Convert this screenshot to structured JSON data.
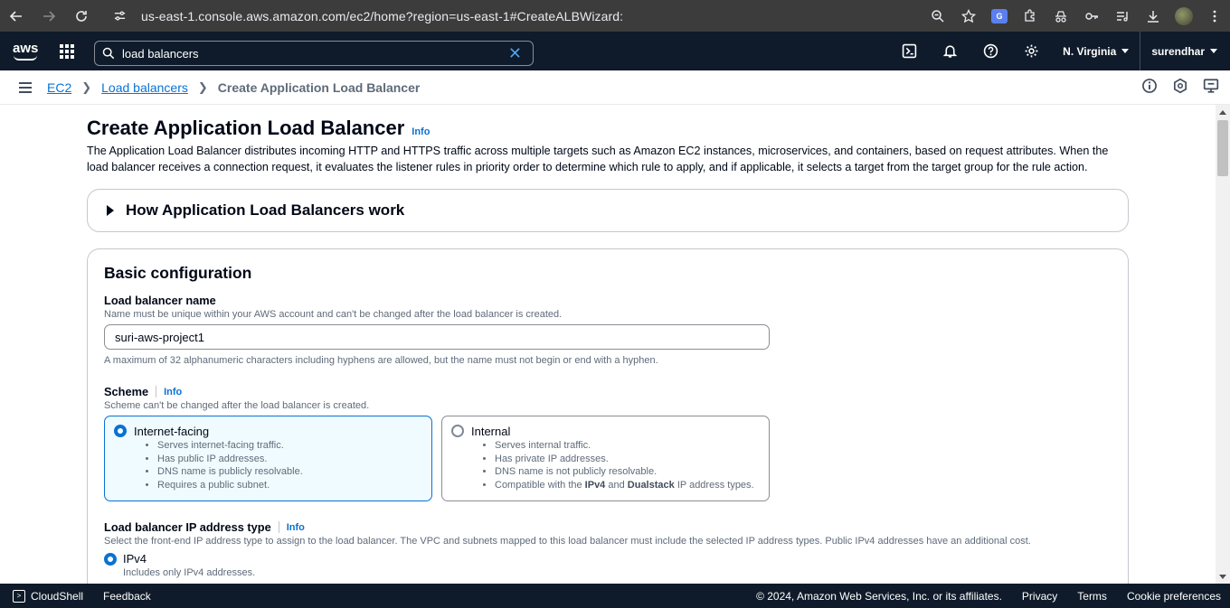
{
  "browser": {
    "url": "us-east-1.console.aws.amazon.com/ec2/home?region=us-east-1#CreateALBWizard:",
    "extension_badge": "G"
  },
  "aws_nav": {
    "logo": "aws",
    "search_value": "load balancers",
    "region": "N. Virginia",
    "user": "surendhar"
  },
  "breadcrumb": {
    "items": [
      "EC2",
      "Load balancers"
    ],
    "current": "Create Application Load Balancer"
  },
  "page": {
    "title": "Create Application Load Balancer",
    "info_label": "Info",
    "description": "The Application Load Balancer distributes incoming HTTP and HTTPS traffic across multiple targets such as Amazon EC2 instances, microservices, and containers, based on request attributes. When the load balancer receives a connection request, it evaluates the listener rules in priority order to determine which rule to apply, and if applicable, it selects a target from the target group for the rule action.",
    "expander_title": "How Application Load Balancers work"
  },
  "basic_config": {
    "title": "Basic configuration",
    "name_label": "Load balancer name",
    "name_desc": "Name must be unique within your AWS account and can't be changed after the load balancer is created.",
    "name_value": "suri-aws-project1",
    "name_constraint": "A maximum of 32 alphanumeric characters including hyphens are allowed, but the name must not begin or end with a hyphen.",
    "scheme_label": "Scheme",
    "scheme_info": "Info",
    "scheme_desc": "Scheme can't be changed after the load balancer is created.",
    "internet_facing": {
      "title": "Internet-facing",
      "bullets": [
        "Serves internet-facing traffic.",
        "Has public IP addresses.",
        "DNS name is publicly resolvable.",
        "Requires a public subnet."
      ]
    },
    "internal": {
      "title": "Internal",
      "bullets": [
        "Serves internal traffic.",
        "Has private IP addresses.",
        "DNS name is not publicly resolvable."
      ],
      "last_prefix": "Compatible with the ",
      "last_b1": "IPv4",
      "last_mid": " and ",
      "last_b2": "Dualstack",
      "last_suffix": " IP address types."
    },
    "ip_label": "Load balancer IP address type",
    "ip_info": "Info",
    "ip_desc": "Select the front-end IP address type to assign to the load balancer. The VPC and subnets mapped to this load balancer must include the selected IP address types. Public IPv4 addresses have an additional cost.",
    "ipv4_label": "IPv4",
    "ipv4_desc": "Includes only IPv4 addresses."
  },
  "footer": {
    "cloudshell": "CloudShell",
    "feedback": "Feedback",
    "copyright": "© 2024, Amazon Web Services, Inc. or its affiliates.",
    "privacy": "Privacy",
    "terms": "Terms",
    "cookies": "Cookie preferences"
  }
}
